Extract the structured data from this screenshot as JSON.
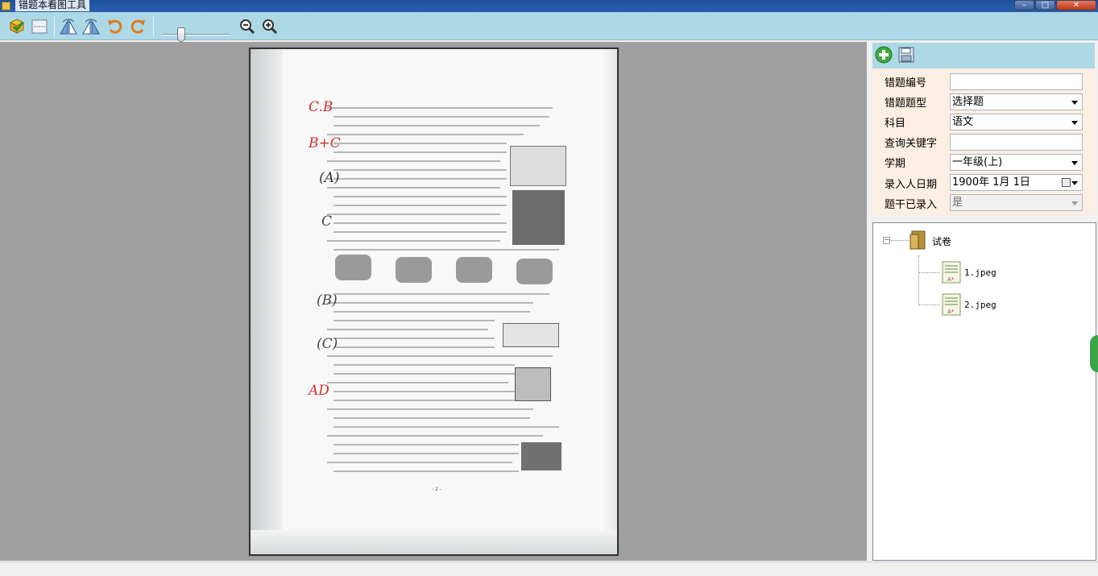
{
  "window": {
    "title": "错题本看图工具",
    "controls": {
      "minimize": "–",
      "maximize": "□",
      "close": "✕"
    }
  },
  "toolbar": {
    "buttons": [
      {
        "name": "open-icon",
        "color": "#2e8b2e"
      },
      {
        "name": "fit-page-icon",
        "color": "#6b7f99"
      },
      {
        "name": "flip-horizontal-icon",
        "color": "#3b6fb5"
      },
      {
        "name": "flip-vertical-icon",
        "color": "#3b6fb5"
      },
      {
        "name": "rotate-left-icon",
        "color": "#e07b1c"
      },
      {
        "name": "rotate-right-icon",
        "color": "#e07b1c"
      },
      {
        "name": "zoom-out-icon",
        "color": "#333333"
      },
      {
        "name": "zoom-in-icon",
        "color": "#333333"
      }
    ],
    "zoom_slider_value": 0.25
  },
  "form": {
    "fields": [
      {
        "label": "错题编号",
        "value": "",
        "type": "text"
      },
      {
        "label": "错题题型",
        "value": "选择题",
        "type": "dropdown"
      },
      {
        "label": "科目",
        "value": "语文",
        "type": "dropdown"
      },
      {
        "label": "查询关键字",
        "value": "",
        "type": "text"
      },
      {
        "label": "学期",
        "value": "一年级(上)",
        "type": "dropdown"
      },
      {
        "label": "录入人日期",
        "value": "1900年  1月  1日",
        "type": "date"
      },
      {
        "label": "题干已录入",
        "value": "是",
        "type": "dropdown-disabled"
      }
    ]
  },
  "tree": {
    "root": "试卷",
    "items": [
      "1.jpeg",
      "2.jpeg"
    ]
  },
  "document": {
    "annotations": [
      "C.B",
      "B+C",
      "(A)",
      "C",
      "(B)",
      "(C)",
      "AD"
    ],
    "page_number": "- 2 -"
  },
  "colors": {
    "toolbar": "#add8e6",
    "viewer_bg": "#a0a0a0",
    "form_bg": "#fbeee2"
  }
}
